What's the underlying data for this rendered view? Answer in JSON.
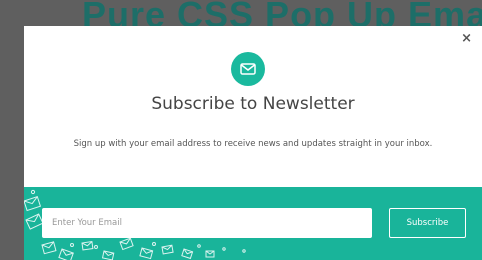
{
  "background": {
    "title": "Pure CSS Pop Up Email Sign"
  },
  "modal": {
    "close_label": "×",
    "icon": "envelope-icon",
    "title": "Subscribe to Newsletter",
    "description": "Sign up with your email address to receive news and updates straight in your inbox.",
    "email_placeholder": "Enter Your Email",
    "subscribe_label": "Subscribe"
  },
  "colors": {
    "accent": "#1ab99e",
    "backdrop": "#5f5f5f",
    "background_title": "#1d6e68"
  }
}
